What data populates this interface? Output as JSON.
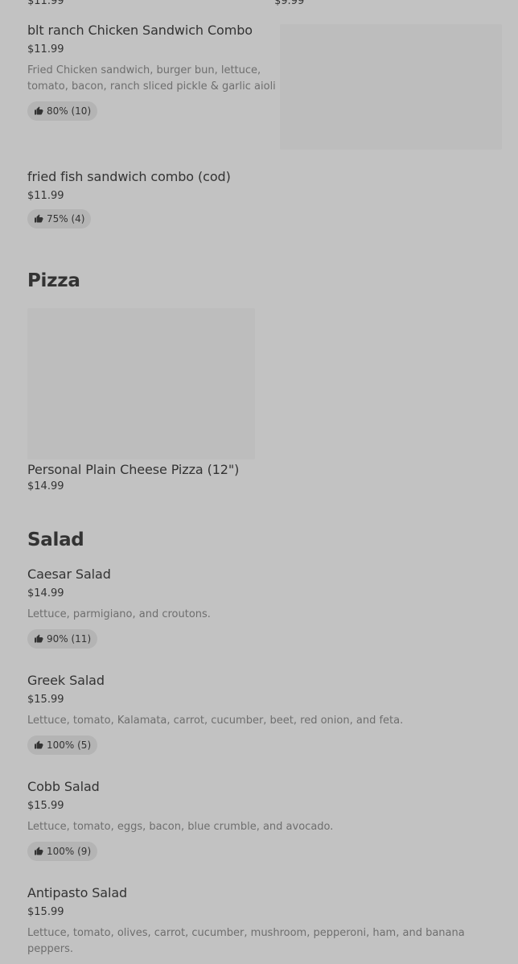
{
  "top_partial": {
    "left_price": "$11.99",
    "right_price": "$9.99"
  },
  "sections": {
    "sandwich_items": [
      {
        "name": "blt ranch Chicken Sandwich Combo",
        "price": "$11.99",
        "description": "Fried Chicken sandwich, burger bun, lettuce, tomato, bacon, ranch sliced pickle & garlic aioli",
        "rating": "80% (10)"
      },
      {
        "name": "fried fish sandwich combo (cod)",
        "price": "$11.99",
        "rating": "75% (4)"
      }
    ],
    "pizza": {
      "title": "Pizza",
      "items": [
        {
          "name": "Personal Plain Cheese Pizza (12\")",
          "price": "$14.99"
        }
      ]
    },
    "salad": {
      "title": "Salad",
      "items": [
        {
          "name": "Caesar Salad",
          "price": "$14.99",
          "description": "Lettuce, parmigiano, and croutons.",
          "rating": "90% (11)"
        },
        {
          "name": "Greek Salad",
          "price": "$15.99",
          "description": "Lettuce, tomato, Kalamata, carrot, cucumber, beet, red onion, and feta.",
          "rating": "100% (5)"
        },
        {
          "name": "Cobb Salad",
          "price": "$15.99",
          "description": "Lettuce, tomato, eggs, bacon, blue crumble, and avocado.",
          "rating": "100% (9)"
        },
        {
          "name": "Antipasto Salad",
          "price": "$15.99",
          "description": "Lettuce, tomato, olives, carrot, cucumber, mushroom, pepperoni, ham, and banana peppers."
        }
      ]
    }
  },
  "icons": {
    "rating": "thumbs-up-icon"
  }
}
